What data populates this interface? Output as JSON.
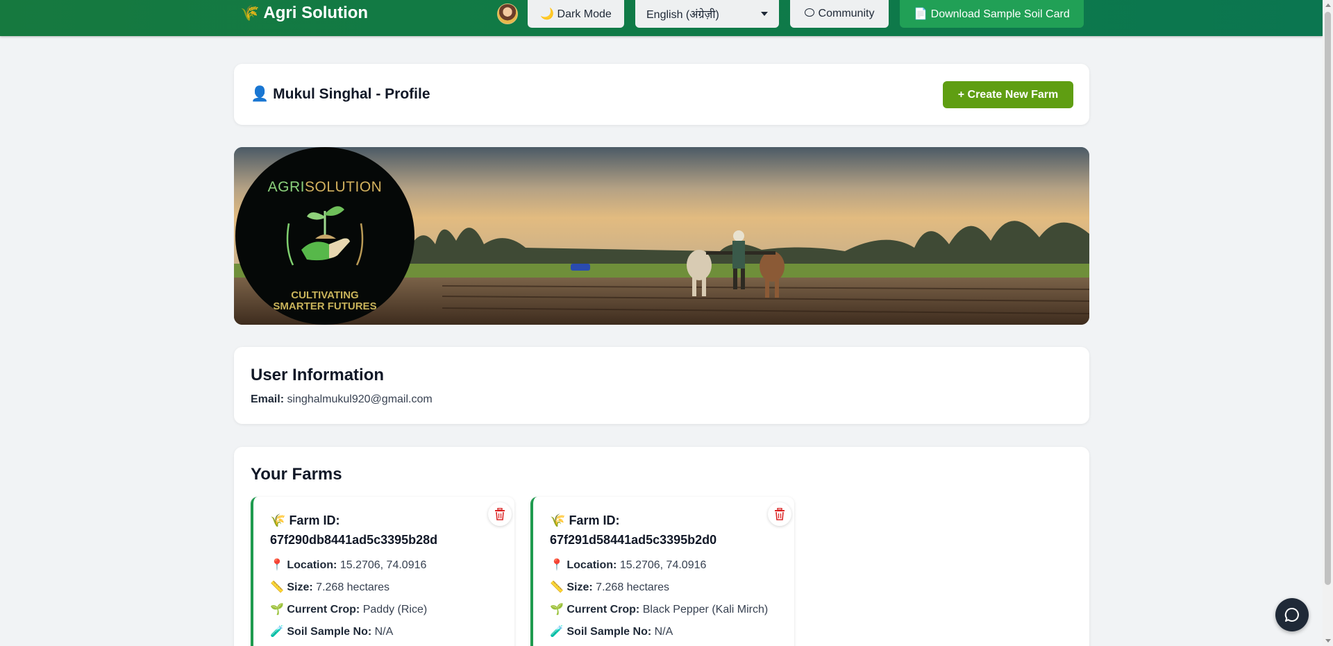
{
  "header": {
    "brand_icon": "🌾",
    "brand_name": "Agri Solution",
    "dark_mode_label": "🌙 Dark Mode",
    "language_selected": "English (अंग्रेज़ी)",
    "community_label": "Community",
    "download_label": "📄 Download Sample Soil Card",
    "colors": {
      "bar": "#16793f",
      "download": "#21a056"
    }
  },
  "profile": {
    "icon": "👤",
    "title": "Mukul Singhal - Profile",
    "create_farm_label": "+ Create New Farm",
    "create_color": "#5f9e12"
  },
  "logo": {
    "title_part1": "AGRI",
    "title_part2": "SOLUTION",
    "tagline_line1": "CULTIVATING",
    "tagline_line2": "SMARTER FUTURES"
  },
  "user_info": {
    "title": "User Information",
    "email_label": "Email:",
    "email_value": "singhalmukul920@gmail.com"
  },
  "farms": {
    "title": "Your Farms",
    "accent": "#1f9b4f",
    "items": [
      {
        "icon": "🌾",
        "title_label": "Farm ID:",
        "id": "67f290db8441ad5c3395b28d",
        "location_icon": "📍",
        "location_label": "Location:",
        "location_value": "15.2706, 74.0916",
        "size_icon": "📏",
        "size_label": "Size:",
        "size_value": "7.268 hectares",
        "crop_icon": "🌱",
        "crop_label": "Current Crop:",
        "crop_value": "Paddy (Rice)",
        "soil_icon": "🧪",
        "soil_label": "Soil Sample No:",
        "soil_value": "N/A"
      },
      {
        "icon": "🌾",
        "title_label": "Farm ID:",
        "id": "67f291d58441ad5c3395b2d0",
        "location_icon": "📍",
        "location_label": "Location:",
        "location_value": "15.2706, 74.0916",
        "size_icon": "📏",
        "size_label": "Size:",
        "size_value": "7.268 hectares",
        "crop_icon": "🌱",
        "crop_label": "Current Crop:",
        "crop_value": "Black Pepper (Kali Mirch)",
        "soil_icon": "🧪",
        "soil_label": "Soil Sample No:",
        "soil_value": "N/A"
      }
    ]
  }
}
